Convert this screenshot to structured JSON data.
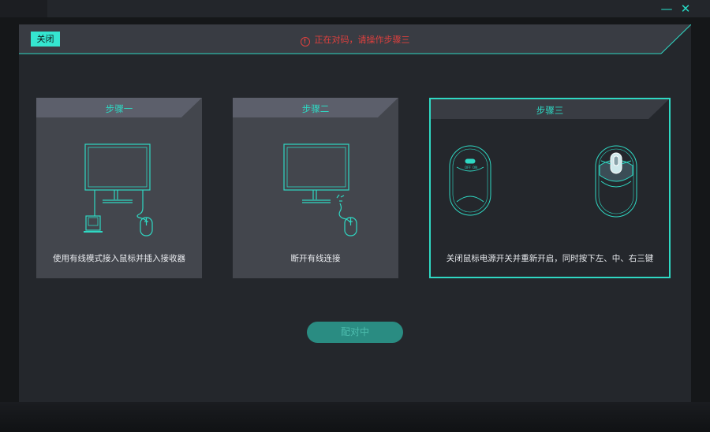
{
  "window": {
    "minimize_icon": "minus-icon",
    "close_icon": "close-icon"
  },
  "dialog": {
    "close_label": "关闭",
    "status_text": "正在对码，请操作步骤三",
    "status_icon": "warning-circle-icon",
    "accent_color": "#2fd8c3",
    "status_color": "#e0403e"
  },
  "steps": [
    {
      "title": "步骤一",
      "description": "使用有线模式接入鼠标并插入接收器"
    },
    {
      "title": "步骤二",
      "description": "断开有线连接"
    },
    {
      "title": "步骤三",
      "description": "关闭鼠标电源开关并重新开启，同时按下左、中、右三键",
      "switch_labels": [
        "OFF",
        "ON"
      ]
    }
  ],
  "pair_button": {
    "label": "配对中"
  }
}
